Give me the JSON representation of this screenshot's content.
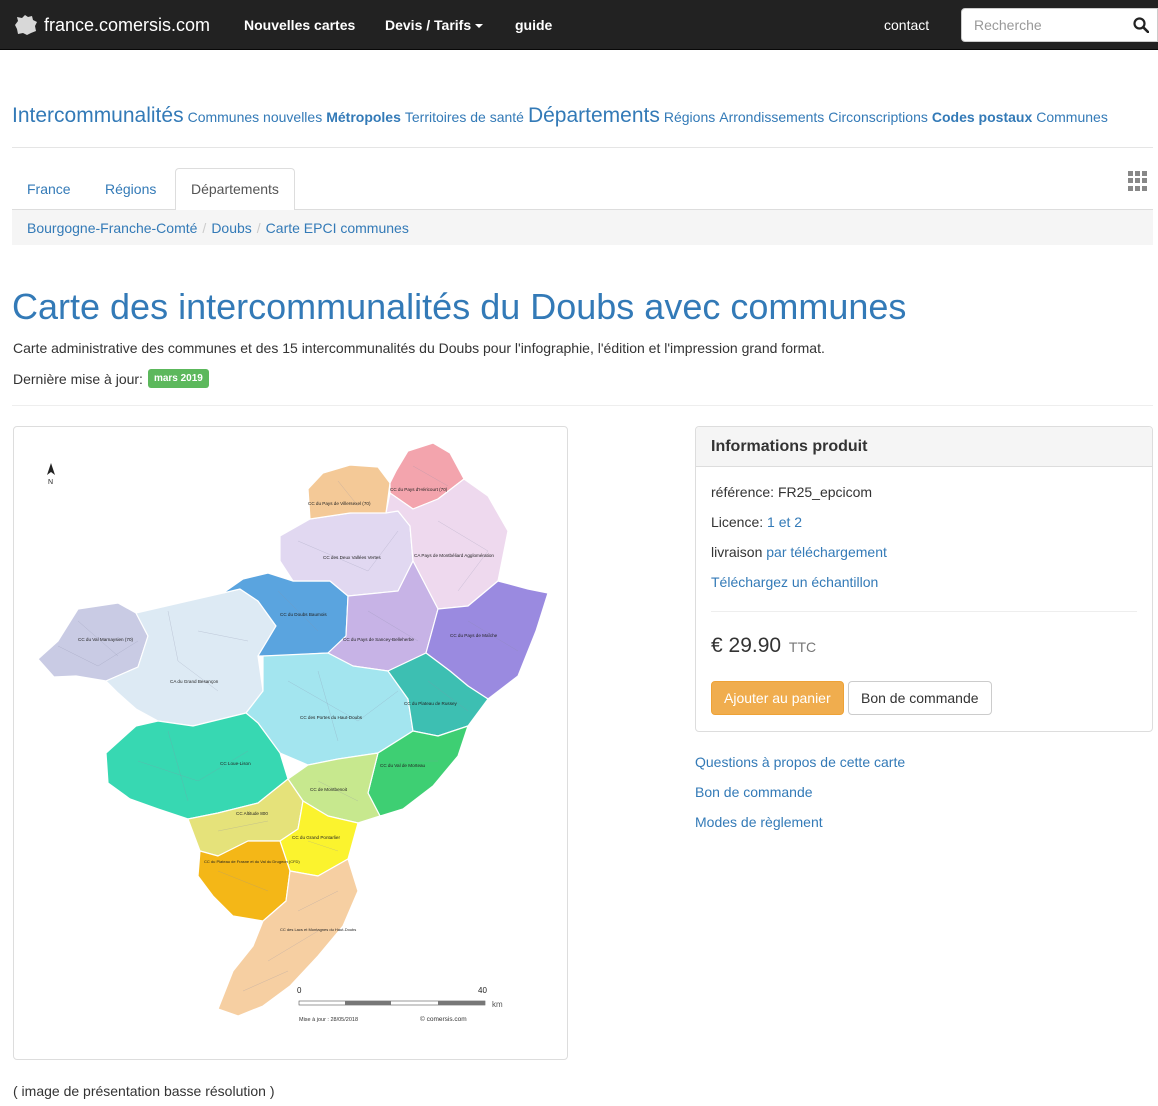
{
  "navbar": {
    "brand": "france.comersis.com",
    "items": [
      "Nouvelles cartes",
      "Devis / Tarifs",
      "guide"
    ],
    "contact": "contact",
    "search_placeholder": "Recherche"
  },
  "categories": [
    {
      "label": "Intercommunalités",
      "style": "lg"
    },
    {
      "label": "Communes nouvelles",
      "style": "md"
    },
    {
      "label": "Métropoles",
      "style": "b"
    },
    {
      "label": "Territoires de santé",
      "style": "md"
    },
    {
      "label": "Départements",
      "style": "lg"
    },
    {
      "label": "Régions",
      "style": "md"
    },
    {
      "label": "Arrondissements",
      "style": "md"
    },
    {
      "label": "Circonscriptions",
      "style": "md"
    },
    {
      "label": "Codes postaux",
      "style": "b"
    },
    {
      "label": "Communes",
      "style": "md"
    }
  ],
  "tabs": [
    "France",
    "Régions",
    "Départements"
  ],
  "active_tab": "Départements",
  "breadcrumb": [
    "Bourgogne-Franche-Comté",
    "Doubs",
    "Carte EPCI communes"
  ],
  "page": {
    "title": "Carte des intercommunalités du Doubs avec communes",
    "description": "Carte administrative des communes et des 15 intercommunalités du Doubs pour l'infographie, l'édition et l'impression grand format.",
    "update_label": "Dernière mise à jour:",
    "update_date": "mars 2019",
    "caption": "( image de présentation basse résolution )"
  },
  "map": {
    "labels": [
      "CC du Pays de Villersexel (70)",
      "CC du Pays d'Héricourt (70)",
      "CC des Deux Vallées Vertes",
      "CA Pays de Montbéliard Agglomération",
      "CC du Doubs Baumois",
      "CC du Pays de Sancey-Belleherbe",
      "CC du Pays de Maîche",
      "CC du Val Marnaysien (70)",
      "CA du Grand Besançon",
      "CC des Portes du Haut-Doubs",
      "CC du Plateau de Russey",
      "CC Loue-Lison",
      "CC du Val de Morteau",
      "CC de Montbenoit",
      "CC Altitude 800",
      "CC du Grand Pontarlier",
      "CC du Plateau de Frasne et du Val du Drugeon (CFD)",
      "CC des Lacs et Montagnes du Haut-Doubs"
    ],
    "north": "N",
    "scale_start": "0",
    "scale_end": "40",
    "scale_unit": "km",
    "date_note": "Mise à jour : 28/05/2018",
    "copyright": "© comersis.com"
  },
  "product": {
    "heading": "Informations produit",
    "reference_label": "référence:",
    "reference": "FR25_epcicom",
    "licence_label": "Licence:",
    "licence": "1 et 2",
    "delivery_label": "livraison",
    "delivery": "par téléchargement",
    "sample": "Téléchargez un échantillon",
    "price": "€ 29.90",
    "price_suffix": "TTC",
    "add_cart": "Ajouter au panier",
    "order_form": "Bon de commande"
  },
  "side_links": [
    "Questions à propos de cette carte",
    "Bon de commande",
    "Modes de règlement"
  ],
  "colors": {
    "navbar": "#222222",
    "link": "#337ab7",
    "badge_green": "#5cb85c",
    "btn_warning": "#f0ad4e"
  }
}
